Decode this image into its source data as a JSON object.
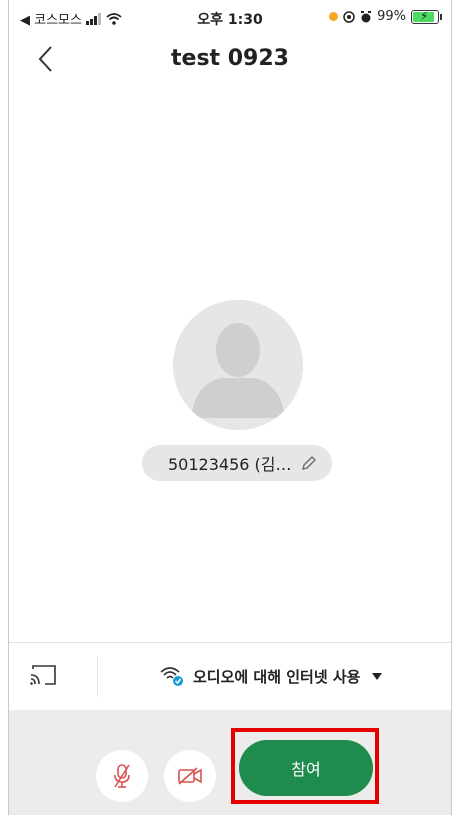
{
  "status_bar": {
    "carrier": "◀ 코스모스",
    "time": "오후 1:30",
    "battery": "99%"
  },
  "header": {
    "title": "test 0923"
  },
  "participant": {
    "display_name": "50123456 (김…"
  },
  "audio": {
    "option_label": "오디오에 대해 인터넷 사용"
  },
  "controls": {
    "join_label": "참여"
  },
  "colors": {
    "join_green": "#1f8b4c",
    "highlight_red": "#e50000",
    "mute_red": "#d9534f"
  }
}
